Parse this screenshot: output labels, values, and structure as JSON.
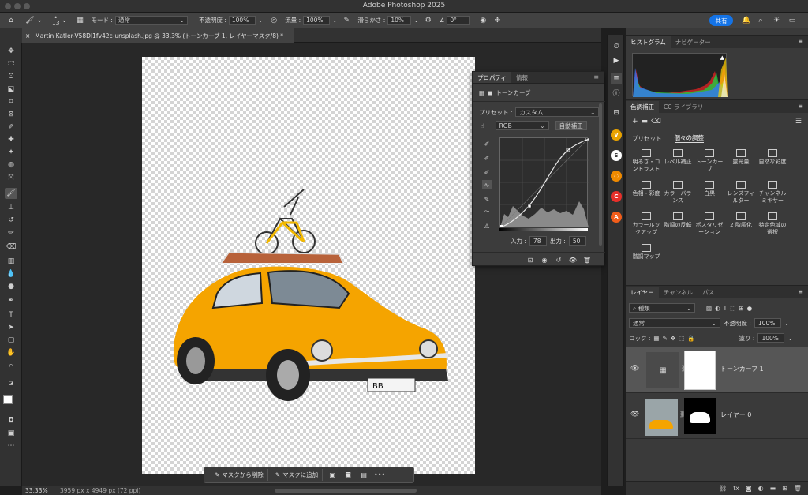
{
  "window": {
    "title": "Adobe Photoshop 2025"
  },
  "options_bar": {
    "brush_size": "13",
    "mode_label": "モード :",
    "mode_value": "通常",
    "opacity_label": "不透明度 :",
    "opacity_value": "100%",
    "flow_label": "流量 :",
    "flow_value": "100%",
    "smoothing_label": "滑らかさ :",
    "smoothing_value": "10%",
    "angle_value": "0°",
    "share_label": "共有"
  },
  "document": {
    "tab_title": "Martin Katler-V58DI1fv42c-unsplash.jpg @ 33,3% (トーンカーブ 1, レイヤーマスク/8) *",
    "close_glyph": "×"
  },
  "status_bar": {
    "zoom": "33,33%",
    "doc_info": "3959 px x 4949 px (72 ppi)"
  },
  "context_bar": {
    "subtract_label": "マスクから削除",
    "add_label": "マスクに追加",
    "more_glyph": "•••"
  },
  "properties_panel": {
    "tabs": [
      "プロパティ",
      "情報"
    ],
    "adjustment_name": "トーンカーブ",
    "preset_label": "プリセット :",
    "preset_value": "カスタム",
    "channel_value": "RGB",
    "auto_label": "自動補正",
    "input_label": "入力 :",
    "input_value": "78",
    "output_label": "出力 :",
    "output_value": "50"
  },
  "histogram_panel": {
    "tabs": [
      "ヒストグラム",
      "ナビゲーター"
    ]
  },
  "adjustments_panel": {
    "tabs": [
      "色調補正",
      "CC ライブラリ"
    ],
    "subtabs": [
      "プリセット",
      "個々の調整"
    ],
    "items": [
      {
        "label": "明るさ・コントラスト",
        "icon": "sun-icon"
      },
      {
        "label": "レベル補正",
        "icon": "levels-icon"
      },
      {
        "label": "トーンカーブ",
        "icon": "curves-icon"
      },
      {
        "label": "露光量",
        "icon": "exposure-icon"
      },
      {
        "label": "自然な彩度",
        "icon": "vibrance-icon"
      },
      {
        "label": "色相・彩度",
        "icon": "hue-icon"
      },
      {
        "label": "カラーバランス",
        "icon": "balance-icon"
      },
      {
        "label": "白黒",
        "icon": "bw-icon"
      },
      {
        "label": "レンズフィルター",
        "icon": "lens-icon"
      },
      {
        "label": "チャンネルミキサー",
        "icon": "mixer-icon"
      },
      {
        "label": "カラールックアップ",
        "icon": "lookup-icon"
      },
      {
        "label": "階調の反転",
        "icon": "invert-icon"
      },
      {
        "label": "ポスタリゼーション",
        "icon": "posterize-icon"
      },
      {
        "label": "2 階調化",
        "icon": "threshold-icon"
      },
      {
        "label": "特定色域の選択",
        "icon": "selective-icon"
      },
      {
        "label": "階調マップ",
        "icon": "gradient-map-icon"
      }
    ]
  },
  "layers_panel": {
    "tabs": [
      "レイヤー",
      "チャンネル",
      "パス"
    ],
    "filter_value": "種類",
    "blend_value": "通常",
    "opacity_label": "不透明度 :",
    "opacity_value": "100%",
    "lock_label": "ロック :",
    "fill_label": "塗り :",
    "fill_value": "100%",
    "layers": [
      {
        "name": "トーンカーブ 1",
        "selected": true
      },
      {
        "name": "レイヤー 0",
        "selected": false
      }
    ],
    "footer_fx": "fx"
  },
  "colors": {
    "accent": "#1473e6",
    "car": "#f5a400"
  }
}
